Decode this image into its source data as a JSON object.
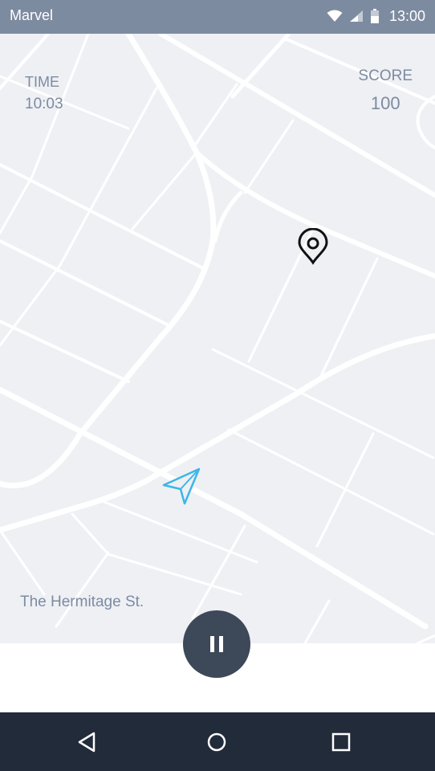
{
  "status_bar": {
    "app_name": "Marvel",
    "time": "13:00",
    "icons": [
      "wifi-icon",
      "signal-icon",
      "battery-icon"
    ]
  },
  "hud": {
    "time_label": "TIME",
    "time_value": "10:03",
    "score_label": "SCORE",
    "score_value": "100"
  },
  "map": {
    "street_name": "The Hermitage St.",
    "destination_icon": "location-pin-icon",
    "player_icon": "navigation-arrow-icon"
  },
  "controls": {
    "pause_icon": "pause-icon"
  },
  "nav_bar": {
    "icons": [
      "back-icon",
      "home-icon",
      "recent-apps-icon"
    ]
  },
  "colors": {
    "status_bar": "#7d8ba1",
    "map_background": "#eef0f4",
    "road": "#ffffff",
    "hud_text": "#7d8ba1",
    "player_arrow": "#3db6e8",
    "pause_button": "#3d4859",
    "nav_bar": "#222b3a"
  }
}
